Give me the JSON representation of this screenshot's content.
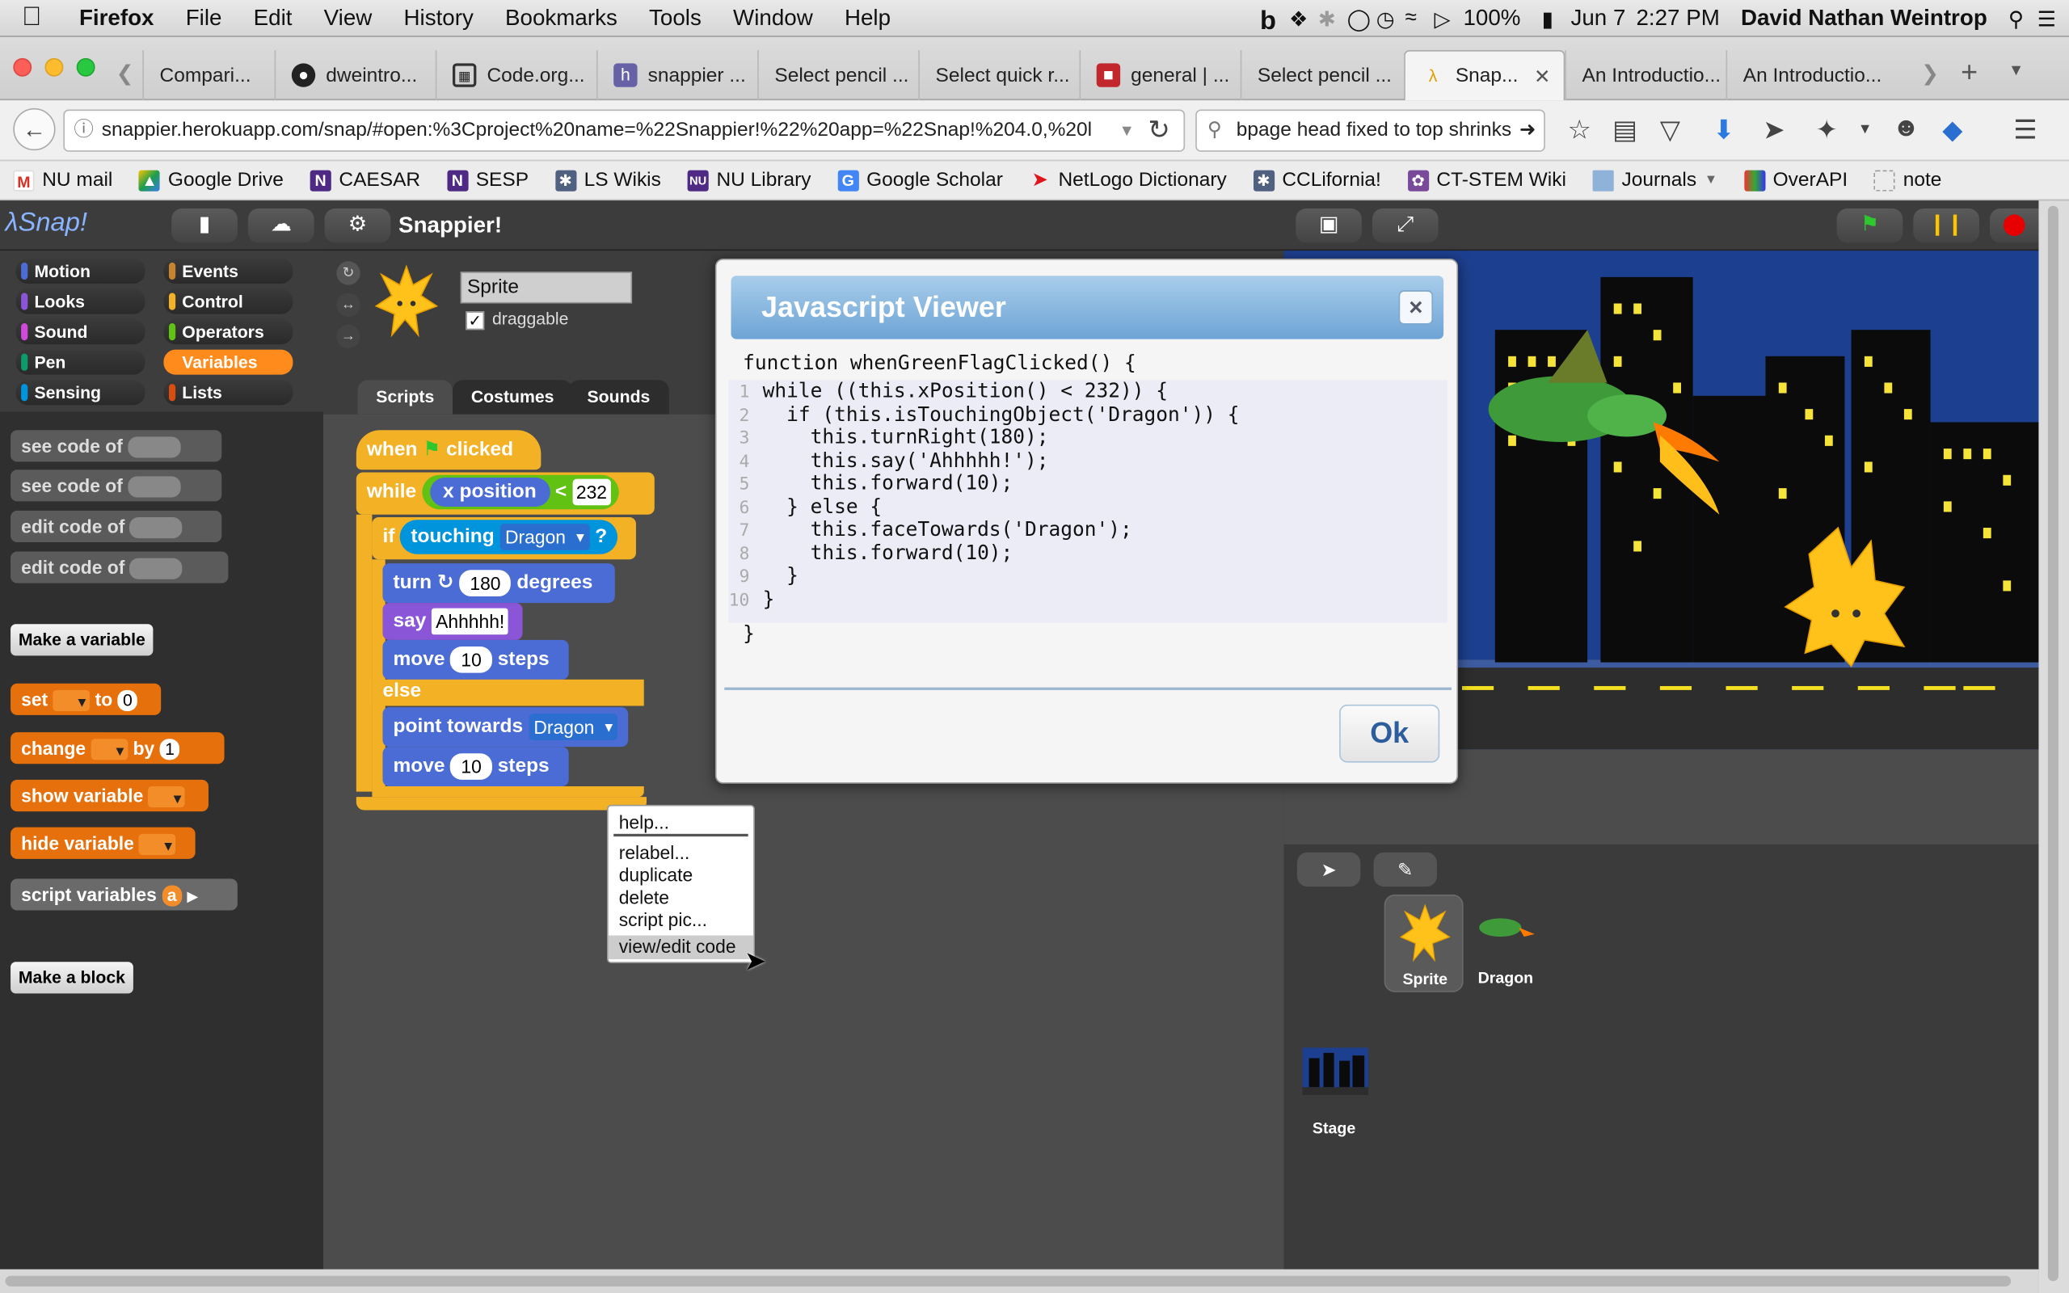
{
  "menubar": {
    "app": "Firefox",
    "items": [
      "File",
      "Edit",
      "View",
      "History",
      "Bookmarks",
      "Tools",
      "Window",
      "Help"
    ],
    "battery": "100%",
    "date": "Jun 7",
    "time": "2:27 PM",
    "user": "David Nathan Weintrop"
  },
  "tabs": [
    {
      "label": "Compari..."
    },
    {
      "label": "dweintro..."
    },
    {
      "label": "Code.org..."
    },
    {
      "label": "snappier ..."
    },
    {
      "label": "Select pencil ..."
    },
    {
      "label": "Select quick r..."
    },
    {
      "label": "general | ..."
    },
    {
      "label": "Select pencil ..."
    },
    {
      "label": "Snap..."
    },
    {
      "label": "An Introductio..."
    },
    {
      "label": "An Introductio..."
    }
  ],
  "nav": {
    "url": "snappier.herokuapp.com/snap/#open:%3Cproject%20name=%22Snappier!%22%20app=%22Snap!%204.0,%20l",
    "search": "bpage head fixed to top shrinks"
  },
  "bookmarks": [
    "NU mail",
    "Google Drive",
    "CAESAR",
    "SESP",
    "LS Wikis",
    "NU Library",
    "Google Scholar",
    "NetLogo Dictionary",
    "CCLifornia!",
    "CT-STEM Wiki",
    "Journals",
    "OverAPI",
    "note"
  ],
  "snap": {
    "logo": "Snap!",
    "project_title": "Snappier!",
    "categories": [
      "Motion",
      "Events",
      "Looks",
      "Control",
      "Sound",
      "Operators",
      "Pen",
      "Variables",
      "Sensing",
      "Lists"
    ],
    "palette": {
      "see_code_1": "see code of",
      "see_code_2": "see code of",
      "edit_code_1": "edit code of",
      "edit_code_2": "edit code of",
      "make_variable": "Make a variable",
      "set": "set",
      "to": "to",
      "set_value": "0",
      "change": "change",
      "by": "by",
      "change_value": "1",
      "show_variable": "show variable",
      "hide_variable": "hide variable",
      "script_variables": "script variables",
      "script_var_a": "a",
      "make_block": "Make a block"
    },
    "sprite": {
      "name": "Sprite",
      "draggable": "draggable"
    },
    "editor_tabs": [
      "Scripts",
      "Costumes",
      "Sounds"
    ],
    "script": {
      "when": "when",
      "clicked": "clicked",
      "while": "while",
      "x_position": "x position",
      "lt": "<",
      "limit": "232",
      "if": "if",
      "touching": "touching",
      "dragon": "Dragon",
      "q": "?",
      "turn": "turn",
      "turn_value": "180",
      "degrees": "degrees",
      "say": "say",
      "say_value": "Ahhhhh!",
      "move": "move",
      "move_value": "10",
      "steps": "steps",
      "else": "else",
      "point_towards": "point towards",
      "move2_value": "10"
    },
    "context_menu": [
      "help...",
      "relabel...",
      "duplicate",
      "delete",
      "script pic...",
      "view/edit code"
    ],
    "corral": {
      "sprite1": "Sprite",
      "sprite2": "Dragon",
      "stage": "Stage"
    }
  },
  "dialog": {
    "title": "Javascript Viewer",
    "close": "×",
    "fn_line": "function whenGreenFlagClicked() {",
    "lines": [
      "while ((this.xPosition() < 232)) {",
      "  if (this.isTouchingObject('Dragon')) {",
      "    this.turnRight(180);",
      "    this.say('Ahhhhh!');",
      "    this.forward(10);",
      "  } else {",
      "    this.faceTowards('Dragon');",
      "    this.forward(10);",
      "  }",
      "}"
    ],
    "line_numbers": [
      "1",
      "2",
      "3",
      "4",
      "5",
      "6",
      "7",
      "8",
      "9",
      "10"
    ],
    "end_line": "}",
    "ok": "Ok"
  },
  "colors": {
    "motion": "#4a6cd4",
    "looks": "#8a55d7",
    "sound": "#cf4ad9",
    "pen": "#0e9a6c",
    "sensing": "#0094dd",
    "events": "#c88330",
    "control": "#f3b126",
    "operators": "#62c213",
    "variables": "#ff8b1c",
    "lists": "#d94d11"
  }
}
